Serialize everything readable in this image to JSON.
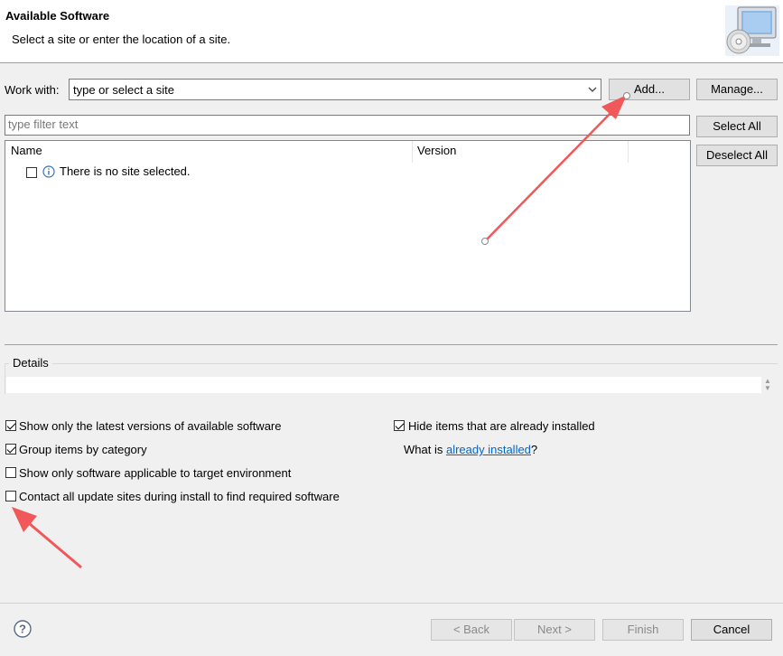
{
  "header": {
    "title": "Available Software",
    "subtitle": "Select a site or enter the location of a site."
  },
  "work_with": {
    "label": "Work with:",
    "value": "type or select a site",
    "add_label": "Add...",
    "manage_label": "Manage..."
  },
  "filter": {
    "placeholder": "type filter text",
    "select_all_label": "Select All",
    "deselect_all_label": "Deselect All"
  },
  "tree": {
    "columns": [
      "Name",
      "Version"
    ],
    "message": "There is no site selected."
  },
  "details": {
    "label": "Details"
  },
  "options": {
    "latest_versions": {
      "label": "Show only the latest versions of available software",
      "checked": true
    },
    "group_by_category": {
      "label": "Group items by category",
      "checked": true
    },
    "target_env": {
      "label": "Show only software applicable to target environment",
      "checked": false
    },
    "contact_sites": {
      "label": "Contact all update sites during install to find required software",
      "checked": false
    },
    "hide_installed": {
      "label": "Hide items that are already installed",
      "checked": true
    },
    "what_is_prefix": "What is ",
    "what_is_link": "already installed",
    "what_is_suffix": "?"
  },
  "footer": {
    "back_label": "< Back",
    "next_label": "Next >",
    "finish_label": "Finish",
    "cancel_label": "Cancel"
  },
  "colors": {
    "annotation_arrow": "#f0585a",
    "link": "#0066cc"
  }
}
